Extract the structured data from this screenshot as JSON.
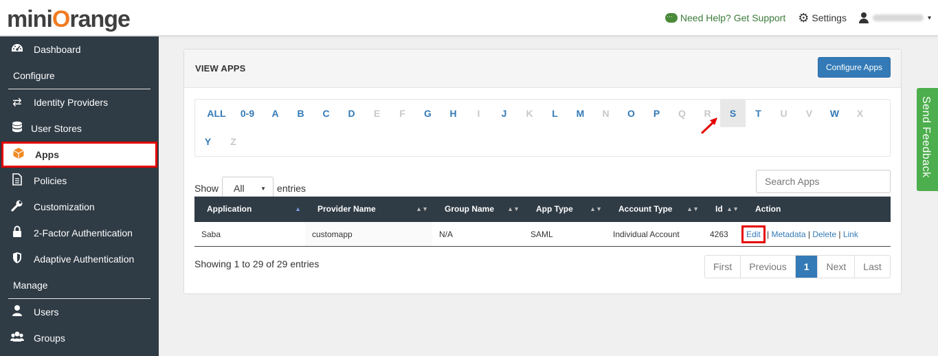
{
  "header": {
    "logo_left": "mini",
    "logo_o": "O",
    "logo_right": "range",
    "help": "Need Help? Get Support",
    "settings": "Settings",
    "caret": "▾"
  },
  "sidebar": {
    "items": [
      {
        "label": "Dashboard",
        "icon": "dashboard-icon"
      },
      {
        "label": "Configure",
        "section": true
      },
      {
        "label": "Identity Providers",
        "icon": "exchange-icon"
      },
      {
        "label": "User Stores",
        "icon": "database-icon"
      },
      {
        "label": "Apps",
        "icon": "cube-icon",
        "active": true
      },
      {
        "label": "Policies",
        "icon": "document-icon"
      },
      {
        "label": "Customization",
        "icon": "wrench-icon"
      },
      {
        "label": "2-Factor Authentication",
        "icon": "lock-icon"
      },
      {
        "label": "Adaptive Authentication",
        "icon": "shield-icon"
      },
      {
        "label": "Manage",
        "section": true
      },
      {
        "label": "Users",
        "icon": "user-icon"
      },
      {
        "label": "Groups",
        "icon": "users-icon"
      }
    ]
  },
  "panel": {
    "title": "VIEW APPS",
    "configure_button": "Configure Apps"
  },
  "alphabet": {
    "row1": [
      {
        "l": "ALL",
        "on": true
      },
      {
        "l": "0-9",
        "on": true
      },
      {
        "l": "A",
        "on": true
      },
      {
        "l": "B",
        "on": true
      },
      {
        "l": "C",
        "on": true
      },
      {
        "l": "D",
        "on": true
      },
      {
        "l": "E",
        "on": false
      },
      {
        "l": "F",
        "on": false
      },
      {
        "l": "G",
        "on": true
      },
      {
        "l": "H",
        "on": true
      },
      {
        "l": "I",
        "on": false
      },
      {
        "l": "J",
        "on": true
      },
      {
        "l": "K",
        "on": false
      },
      {
        "l": "L",
        "on": true
      },
      {
        "l": "M",
        "on": true
      },
      {
        "l": "N",
        "on": false
      },
      {
        "l": "O",
        "on": true
      },
      {
        "l": "P",
        "on": true
      },
      {
        "l": "Q",
        "on": false
      },
      {
        "l": "R",
        "on": false
      },
      {
        "l": "S",
        "on": true,
        "selected": true
      },
      {
        "l": "T",
        "on": true
      },
      {
        "l": "U",
        "on": false
      },
      {
        "l": "V",
        "on": false
      },
      {
        "l": "W",
        "on": true
      },
      {
        "l": "X",
        "on": false
      }
    ],
    "row2": [
      {
        "l": "Y",
        "on": true
      },
      {
        "l": "Z",
        "on": false
      }
    ]
  },
  "controls": {
    "show_label": "Show",
    "show_value": "All",
    "entries_label": "entries",
    "search_placeholder": "Search Apps"
  },
  "table": {
    "headers": [
      "Application",
      "Provider Name",
      "Group Name",
      "App Type",
      "Account Type",
      "Id",
      "Action"
    ],
    "rows": [
      {
        "application": "Saba",
        "provider": "customapp",
        "group": "N/A",
        "app_type": "SAML",
        "account_type": "Individual Account",
        "id": "4263",
        "actions": [
          "Edit",
          "Metadata",
          "Delete",
          "Link"
        ]
      }
    ]
  },
  "footer": {
    "info": "Showing 1 to 29 of 29 entries",
    "pager": [
      "First",
      "Previous",
      "1",
      "Next",
      "Last"
    ],
    "current_page": "1"
  },
  "feedback": "Send Feedback",
  "colors": {
    "sidebar_bg": "#2f3b45",
    "link": "#337ab7",
    "highlight": "#e30000",
    "feedback": "#4cae4c",
    "accent": "#f27b21"
  }
}
